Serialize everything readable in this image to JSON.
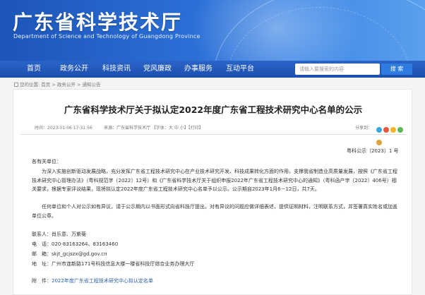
{
  "header": {
    "site_title": "广东省科学技术厅",
    "site_subtitle": "Department of Science and Technology of Guangdong Province"
  },
  "nav": {
    "items": [
      "首页",
      "政务公开",
      "科技资讯",
      "党风廉政",
      "办事服务",
      "互动平台"
    ],
    "search_placeholder": "请输入要搜索的内容",
    "search_button": "搜 索"
  },
  "breadcrumb": {
    "prefix": "您的位置:",
    "items": [
      "首页",
      "政务公开",
      "通知公告"
    ],
    "separator": " > "
  },
  "article": {
    "title": "广东省科学技术厅关于拟认定2022年度广东省工程技术研究中心名单的公示",
    "meta_time": "时间：2023-01-06 17:31:56",
    "meta_source": "来源：广东省科学技术厅 【字体：大  中  小】【打印】",
    "share_label": "分享到：",
    "doc_number": "粤科公示〔2023〕1 号",
    "greeting": "各有关单位：",
    "paragraph1": "为深入实施创新驱动发展战略，充分发挥广东省工程技术研究中心在产业技术研究开发、科技成果转化方面的作用，支撑我省制造业高质量发展，按照《广东省工程技术研究中心管理办法》（粤科规范字〔2022〕12号）和《广东省科学技术厅关于组织申报2022年广东省工程技术研究中心的通知》（粤科函产字〔2022〕406号）相关要求，根据专家评议结果，现将拟认定2022年度广东省工程技术研究中心名单予以公示。公示期自2023年1月6－12日，共7天。",
    "paragraph2": "任何单位和个人对公示如有异议，请于公示期内以书面形式向省科技厅提出，对有异议的问题应做详细表述，提供证明材料，注明联系方式，并签署真实姓名或加盖单位公章。",
    "contacts": [
      {
        "label": "联系人：",
        "value": "肖乐意、万紫菊"
      },
      {
        "label": "电　话：",
        "value": "020-83163264、83163460"
      },
      {
        "label": "邮　箱：",
        "value": "skjt_gcjszx@gd.gov.cn"
      },
      {
        "label": "地　址：",
        "value": "广州市连新路171号科技信息大楼一楼省科技厅综合业务办理大厅"
      }
    ],
    "attachment_label": "附　件：",
    "attachment_link": "2022年度广东省工程技术研究中心拟认定名单"
  },
  "colors": {
    "header_blue": "#2b6fd6",
    "nav_blue": "#1c4fae",
    "link_blue": "#2a5db0",
    "share_colors": [
      "#3aa5e0",
      "#e55a3c",
      "#f0b429",
      "#5bb85c",
      "#e0a23a"
    ]
  }
}
